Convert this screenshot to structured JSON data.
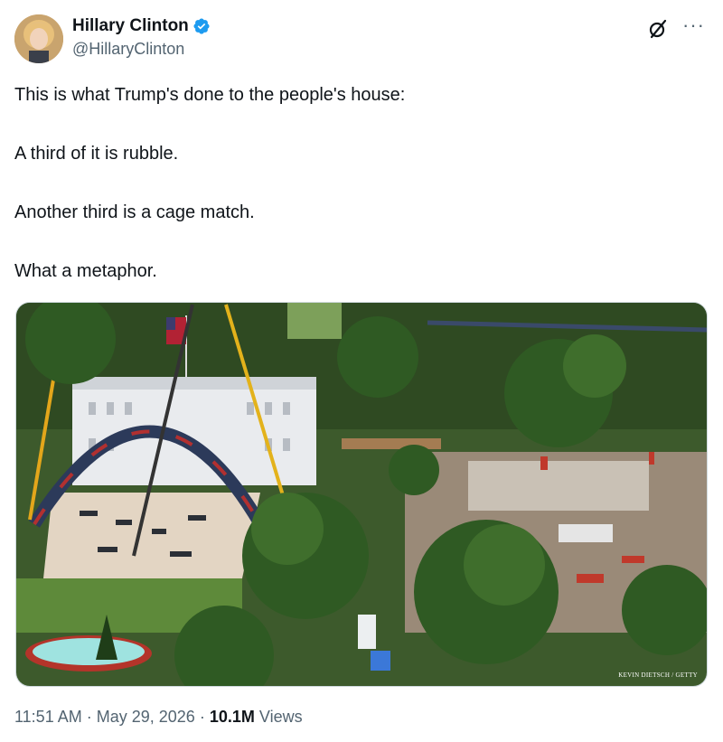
{
  "author": {
    "display_name": "Hillary Clinton",
    "handle": "@HillaryClinton",
    "verified": true,
    "verified_color": "#1d9bf0"
  },
  "header_icons": [
    "grok-icon",
    "more-icon"
  ],
  "tweet": {
    "paragraphs": [
      "This is what Trump's done to the people's house:",
      "A third of it is rubble.",
      "Another third is a cage match.",
      "What a metaphor."
    ]
  },
  "media": {
    "credit": "KEVIN DIETSCH / GETTY"
  },
  "meta": {
    "time": "11:51 AM",
    "separator": "·",
    "date": "May 29, 2026",
    "views_count": "10.1M",
    "views_label": "Views"
  },
  "colors": {
    "text": "#0f1419",
    "secondary": "#536471",
    "accent": "#1d9bf0"
  }
}
